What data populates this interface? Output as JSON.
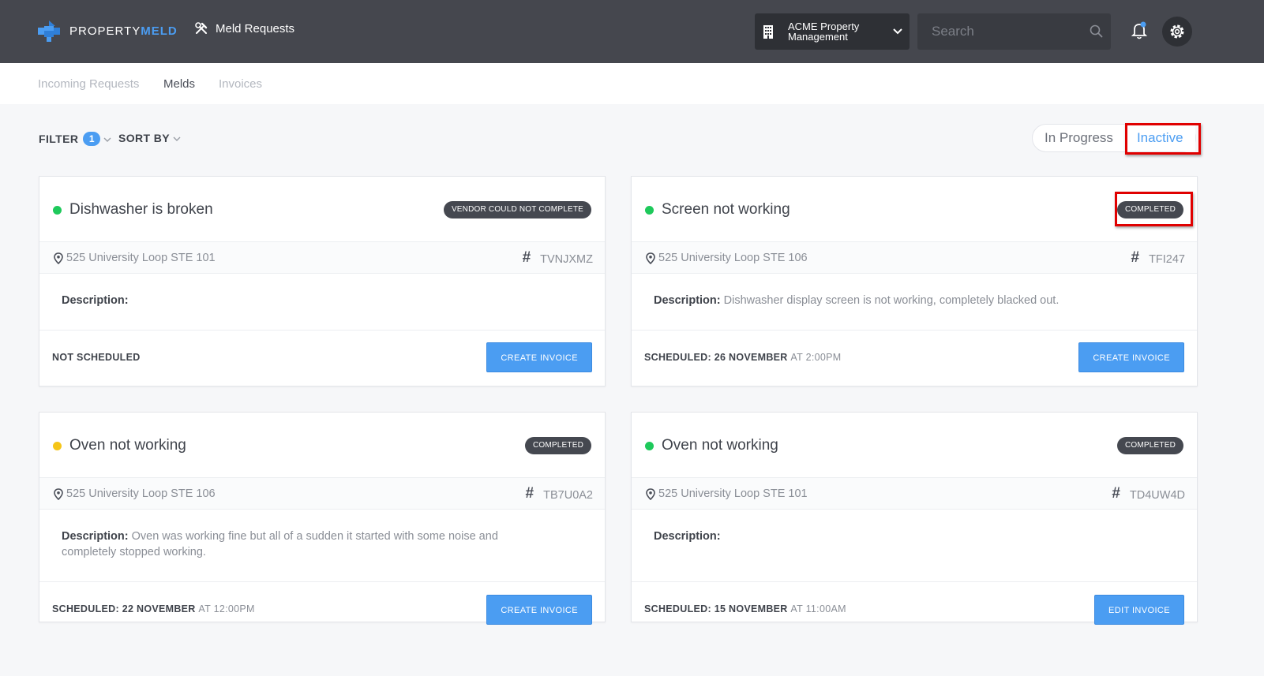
{
  "header": {
    "logo_text_light": "PROPERTY",
    "logo_text_bold": "MELD",
    "app_title": "Meld Requests",
    "organization": {
      "line1": "ACME Property",
      "line2": "Management"
    },
    "search": {
      "placeholder": "Search",
      "value": ""
    },
    "icons": {
      "logo": "propertymeld-logo",
      "tools": "tools-icon",
      "building": "building-icon",
      "chevron": "chevron-down-icon",
      "search": "search-icon",
      "bell": "bell-icon",
      "gear": "gear-icon"
    },
    "colors": {
      "bar": "#45474e",
      "accent": "#4b9df2"
    }
  },
  "subnav": {
    "tabs": [
      {
        "label": "Incoming Requests"
      },
      {
        "label": "Melds"
      },
      {
        "label": "Invoices"
      }
    ],
    "active_tab": "Melds"
  },
  "filters": {
    "filter_label": "FILTER",
    "filter_count": "1",
    "sort_label": "SORT BY",
    "view_toggle": {
      "options": [
        "In Progress",
        "Inactive"
      ],
      "selected": "Inactive"
    }
  },
  "melds": [
    {
      "title": "Dishwasher is broken",
      "status": "VENDOR COULD NOT COMPLETE",
      "dot_color": "#1ec95b",
      "address": "525 University Loop STE 101",
      "ref": "TVNJXMZ",
      "description_label": "Description:",
      "description": "",
      "schedule_main": "NOT SCHEDULED",
      "schedule_time": "",
      "action": "CREATE INVOICE"
    },
    {
      "title": "Screen not working",
      "status": "COMPLETED",
      "dot_color": "#1ec95b",
      "address": "525 University Loop STE 106",
      "ref": "TFI247",
      "description_label": "Description:",
      "description": "Dishwasher display screen is not working, completely blacked out.",
      "schedule_main": "SCHEDULED: 26 NOVEMBER",
      "schedule_time": "AT 2:00PM",
      "action": "CREATE INVOICE"
    },
    {
      "title": "Oven not working",
      "status": "COMPLETED",
      "dot_color": "#f5c518",
      "address": "525 University Loop STE 106",
      "ref": "TB7U0A2",
      "description_label": "Description:",
      "description": "Oven was working fine but all of a sudden it started with some noise and completely stopped working.",
      "schedule_main": "SCHEDULED: 22 NOVEMBER",
      "schedule_time": "AT 12:00PM",
      "action": "CREATE INVOICE"
    },
    {
      "title": "Oven not working",
      "status": "COMPLETED",
      "dot_color": "#1ec95b",
      "address": "525 University Loop STE 101",
      "ref": "TD4UW4D",
      "description_label": "Description:",
      "description": "",
      "schedule_main": "SCHEDULED: 15 NOVEMBER",
      "schedule_time": "AT 11:00AM",
      "action": "EDIT INVOICE"
    }
  ]
}
